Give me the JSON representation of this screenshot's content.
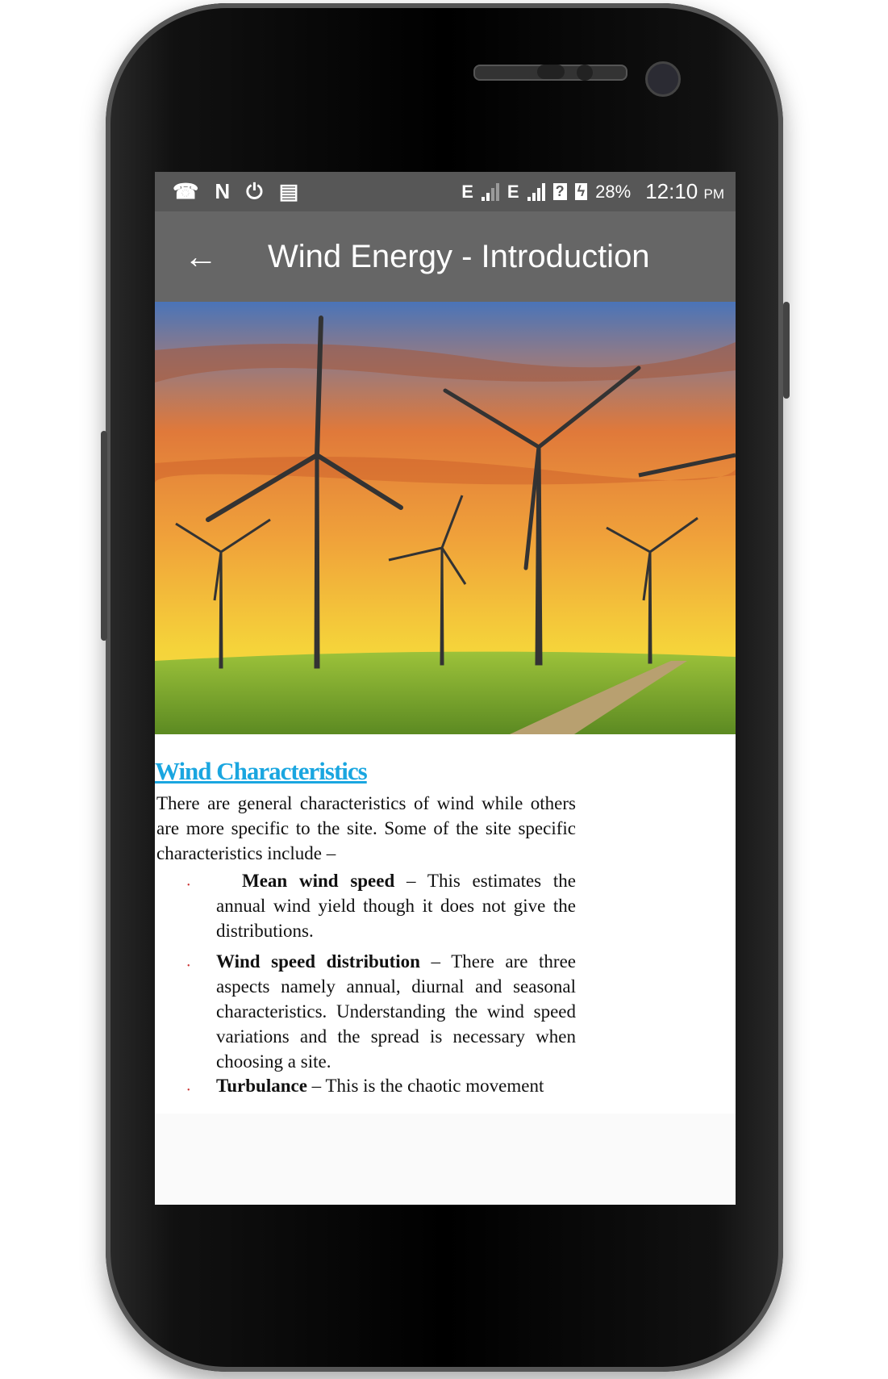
{
  "status_bar": {
    "left_icons": [
      "missed-call-icon",
      "n-icon",
      "upload-icon",
      "news-icon"
    ],
    "network_1": "E",
    "network_2": "E",
    "battery": "28%",
    "time": "12:10",
    "ampm": "PM"
  },
  "toolbar": {
    "title": "Wind Energy - Introduction",
    "back_icon": "arrow-left-icon"
  },
  "article": {
    "heading": "Wind Characteristics",
    "heading_color": "#1aa6e0",
    "intro": "There are general characteristics of wind while others are more specific to the site. Some of the site specific characteristics include –",
    "items": [
      {
        "term": "Mean wind speed",
        "text": " – This estimates the annual wind yield though it does not give the distributions."
      },
      {
        "term": "Wind speed distribution",
        "text": " – There are three aspects namely annual, diurnal and seasonal characteristics. Understanding the wind speed variations and the spread is necessary when choosing a site."
      },
      {
        "term": "Turbulance",
        "text": " – This is the chaotic movement"
      }
    ]
  }
}
